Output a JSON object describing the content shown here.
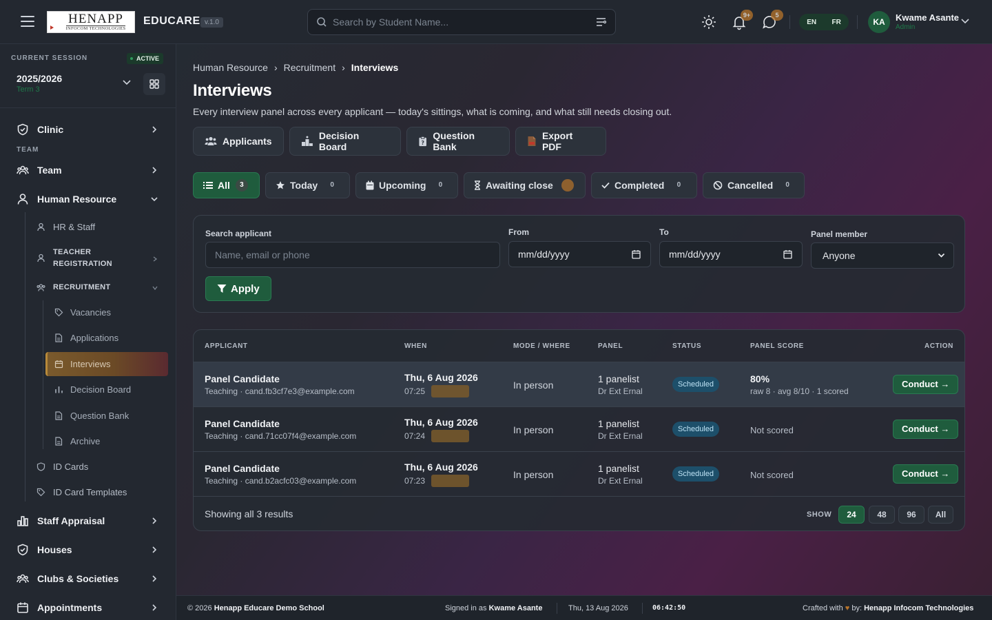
{
  "app": {
    "logo_main": "HENAPP",
    "logo_sub": "INFOCOM TECHNOLOGIES",
    "brand": "EDUCARE",
    "version": "v.1.0"
  },
  "search": {
    "placeholder": "Search by Student Name..."
  },
  "notifications": {
    "bell_count": "9+",
    "chat_count": "5"
  },
  "lang": {
    "en": "EN",
    "fr": "FR"
  },
  "user": {
    "initials": "KA",
    "name": "Kwame Asante",
    "role": "Admin"
  },
  "session": {
    "label": "CURRENT SESSION",
    "status": "ACTIVE",
    "year": "2025/2026",
    "term": "Term 3"
  },
  "sidebar": {
    "clinic": "Clinic",
    "team_section": "TEAM",
    "team": "Team",
    "hr": "Human Resource",
    "hr_staff": "HR & Staff",
    "teacher_reg_1": "TEACHER",
    "teacher_reg_2": "REGISTRATION",
    "recruitment": "RECRUITMENT",
    "vacancies": "Vacancies",
    "applications": "Applications",
    "interviews": "Interviews",
    "decision_board": "Decision Board",
    "question_bank": "Question Bank",
    "archive": "Archive",
    "id_cards": "ID Cards",
    "id_card_templates": "ID Card Templates",
    "staff_appraisal": "Staff Appraisal",
    "houses": "Houses",
    "clubs": "Clubs & Societies",
    "appointments": "Appointments"
  },
  "breadcrumb": {
    "level1": "Human Resource",
    "level2": "Recruitment",
    "current": "Interviews"
  },
  "page": {
    "title": "Interviews",
    "subtitle": "Every interview panel across every applicant — today's sittings, what is coming, and what still needs closing out."
  },
  "actions": {
    "applicants": "Applicants",
    "decision_board": "Decision Board",
    "question_bank": "Question Bank",
    "export_pdf": "Export PDF"
  },
  "filters": {
    "all": {
      "label": "All",
      "count": "3"
    },
    "today": {
      "label": "Today",
      "count": "0"
    },
    "upcoming": {
      "label": "Upcoming",
      "count": "0"
    },
    "awaiting": {
      "label": "Awaiting close",
      "count": ""
    },
    "completed": {
      "label": "Completed",
      "count": "0"
    },
    "cancelled": {
      "label": "Cancelled",
      "count": "0"
    }
  },
  "filter_form": {
    "search_label": "Search applicant",
    "search_placeholder": "Name, email or phone",
    "from_label": "From",
    "from_value": "mm/dd/yyyy",
    "to_label": "To",
    "to_value": "mm/dd/yyyy",
    "panel_label": "Panel member",
    "panel_value": "Anyone",
    "apply": "Apply"
  },
  "table": {
    "headers": {
      "applicant": "APPLICANT",
      "when": "WHEN",
      "mode": "MODE / WHERE",
      "panel": "PANEL",
      "status": "STATUS",
      "score": "PANEL SCORE",
      "action": "ACTION"
    },
    "rows": [
      {
        "name": "Panel Candidate",
        "meta": "Teaching · cand.fb3cf7e3@example.com",
        "date": "Thu, 6 Aug 2026",
        "time": "07:25",
        "mode": "In person",
        "panel": "1 panelist",
        "panelist": "Dr Ext Ernal",
        "status": "Scheduled",
        "score": "80%",
        "score_sub": "raw 8 · avg 8/10 · 1 scored",
        "action": "Conduct →"
      },
      {
        "name": "Panel Candidate",
        "meta": "Teaching · cand.71cc07f4@example.com",
        "date": "Thu, 6 Aug 2026",
        "time": "07:24",
        "mode": "In person",
        "panel": "1 panelist",
        "panelist": "Dr Ext Ernal",
        "status": "Scheduled",
        "score": "Not scored",
        "score_sub": "",
        "action": "Conduct →"
      },
      {
        "name": "Panel Candidate",
        "meta": "Teaching · cand.b2acfc03@example.com",
        "date": "Thu, 6 Aug 2026",
        "time": "07:23",
        "mode": "In person",
        "panel": "1 panelist",
        "panelist": "Dr Ext Ernal",
        "status": "Scheduled",
        "score": "Not scored",
        "score_sub": "",
        "action": "Conduct →"
      }
    ],
    "results": "Showing all 3 results",
    "show_label": "SHOW",
    "page_sizes": [
      "24",
      "48",
      "96",
      "All"
    ]
  },
  "footer": {
    "copyright": "© 2026",
    "school": "Henapp Educare Demo School",
    "signed_in_prefix": "Signed in as",
    "signed_in_user": "Kwame Asante",
    "date": "Thu, 13 Aug 2026",
    "time": "06:42:50",
    "crafted_prefix": "Crafted with",
    "crafted_by": "by:",
    "crafted_company": "Henapp Infocom Technologies"
  },
  "colors": {
    "accent_green": "#1f5c3d",
    "status_blue": "#1d4f6a",
    "active_nav": "#7a5a2c",
    "warn": "#b8742a"
  }
}
